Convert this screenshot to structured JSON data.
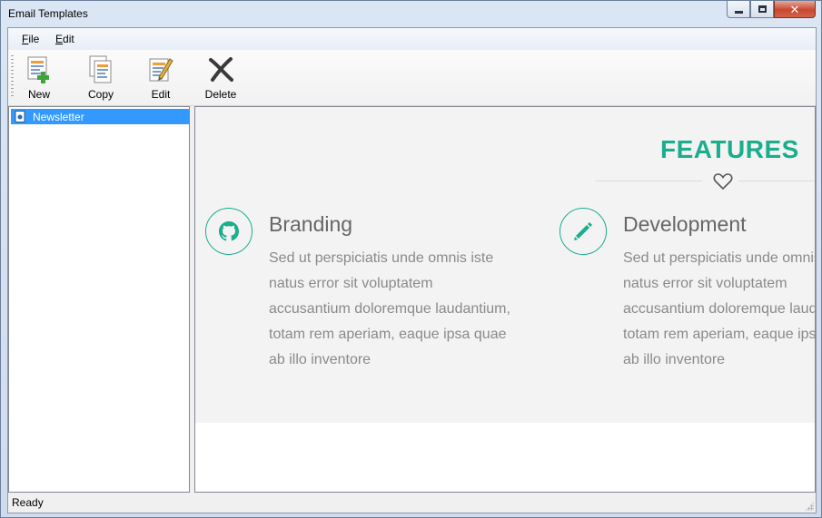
{
  "window": {
    "title": "Email Templates"
  },
  "menu": {
    "items": [
      {
        "label": "File"
      },
      {
        "label": "Edit"
      }
    ]
  },
  "toolbar": {
    "buttons": [
      {
        "label": "New",
        "icon": "new-document-icon"
      },
      {
        "label": "Copy",
        "icon": "copy-document-icon"
      },
      {
        "label": "Edit",
        "icon": "edit-document-icon"
      },
      {
        "label": "Delete",
        "icon": "delete-x-icon"
      }
    ]
  },
  "tree": {
    "items": [
      {
        "label": "Newsletter",
        "selected": true
      }
    ]
  },
  "preview": {
    "heading": "FEATURES",
    "accent_color": "#1aae8c",
    "features": [
      {
        "icon": "github-icon",
        "title": "Branding",
        "lines": [
          "Sed ut perspiciatis unde omnis iste",
          "natus error sit voluptatem",
          "accusantium doloremque laudantium,",
          "totam rem aperiam, eaque ipsa quae",
          "ab illo inventore"
        ]
      },
      {
        "icon": "pencil-icon",
        "title": "Development",
        "lines": [
          "Sed ut perspiciatis unde omnis iste",
          "natus error sit voluptatem",
          "accusantium doloremque laudantium,",
          "totam rem aperiam, eaque ipsa quae",
          "ab illo inventore"
        ]
      }
    ]
  },
  "status": {
    "text": "Ready"
  }
}
